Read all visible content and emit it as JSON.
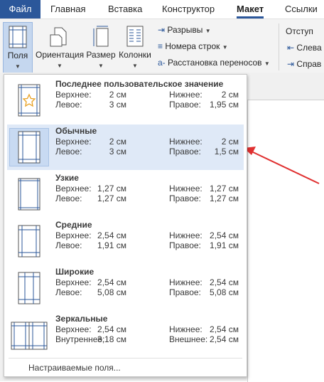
{
  "tabs": {
    "file": "Файл",
    "home": "Главная",
    "insert": "Вставка",
    "design": "Конструктор",
    "layout": "Макет",
    "references": "Ссылки"
  },
  "ribbon": {
    "margins": "Поля",
    "orientation": "Ориентация",
    "size": "Размер",
    "columns": "Колонки",
    "breaks": "Разрывы",
    "line_numbers": "Номера строк",
    "hyphenation": "Расстановка переносов",
    "indent": "Отступ",
    "indent_left": "Слева",
    "indent_right": "Справ"
  },
  "margins_menu": {
    "items": [
      {
        "title": "Последнее пользовательское значение",
        "l1": "Верхнее:",
        "v1": "2 см",
        "l2": "Нижнее:",
        "v2": "2 см",
        "l3": "Левое:",
        "v3": "3 см",
        "l4": "Правое:",
        "v4": "1,95 см"
      },
      {
        "title": "Обычные",
        "l1": "Верхнее:",
        "v1": "2 см",
        "l2": "Нижнее:",
        "v2": "2 см",
        "l3": "Левое:",
        "v3": "3 см",
        "l4": "Правое:",
        "v4": "1,5 см"
      },
      {
        "title": "Узкие",
        "l1": "Верхнее:",
        "v1": "1,27 см",
        "l2": "Нижнее:",
        "v2": "1,27 см",
        "l3": "Левое:",
        "v3": "1,27 см",
        "l4": "Правое:",
        "v4": "1,27 см"
      },
      {
        "title": "Средние",
        "l1": "Верхнее:",
        "v1": "2,54 см",
        "l2": "Нижнее:",
        "v2": "2,54 см",
        "l3": "Левое:",
        "v3": "1,91 см",
        "l4": "Правое:",
        "v4": "1,91 см"
      },
      {
        "title": "Широкие",
        "l1": "Верхнее:",
        "v1": "2,54 см",
        "l2": "Нижнее:",
        "v2": "2,54 см",
        "l3": "Левое:",
        "v3": "5,08 см",
        "l4": "Правое:",
        "v4": "5,08 см"
      },
      {
        "title": "Зеркальные",
        "l1": "Верхнее:",
        "v1": "2,54 см",
        "l2": "Нижнее:",
        "v2": "2,54 см",
        "l3": "Внутреннее:",
        "v3": "3,18 см",
        "l4": "Внешнее:",
        "v4": "2,54 см"
      }
    ],
    "custom": "Настраиваемые поля..."
  },
  "colors": {
    "accent": "#2b579a",
    "selected": "#dfe9f7",
    "annotation_arrow": "#e03030"
  }
}
